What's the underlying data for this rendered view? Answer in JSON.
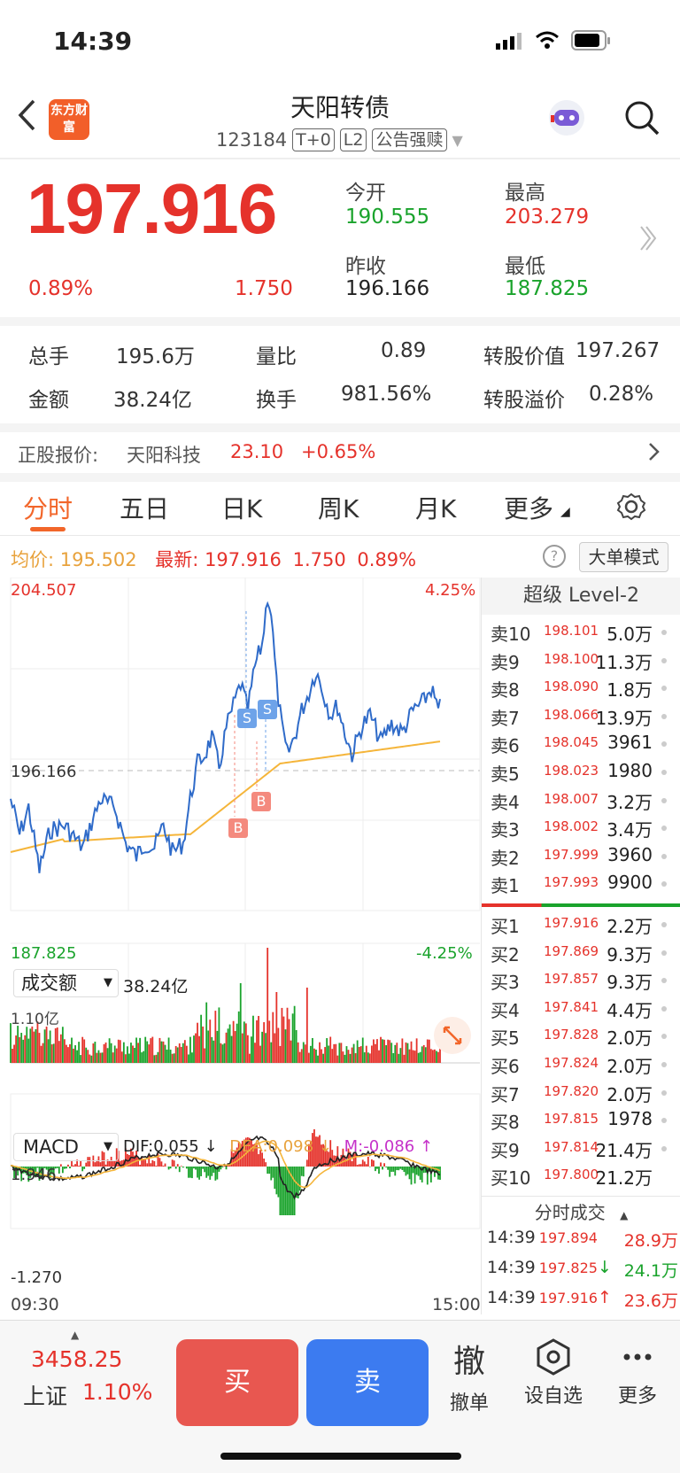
{
  "status": {
    "time": "14:39"
  },
  "header": {
    "title": "天阳转债",
    "code": "123184",
    "tags": [
      "T+0",
      "L2",
      "公告强赎"
    ],
    "logo": "东方财富"
  },
  "quote": {
    "price": "197.916",
    "change_pct": "0.89%",
    "change": "1.750",
    "open_label": "今开",
    "open": "190.555",
    "high_label": "最高",
    "high": "203.279",
    "prev_label": "昨收",
    "prev": "196.166",
    "low_label": "最低",
    "low": "187.825"
  },
  "stats": {
    "vol_label": "总手",
    "vol": "195.6万",
    "ratio_label": "量比",
    "ratio": "0.89",
    "conv_label": "转股价值",
    "conv": "197.267",
    "amt_label": "金额",
    "amt": "38.24亿",
    "turn_label": "换手",
    "turn": "981.56%",
    "prem_label": "转股溢价",
    "prem": "0.28%"
  },
  "stock": {
    "label": "正股报价:",
    "name": "天阳科技",
    "price": "23.10",
    "pct": "+0.65%"
  },
  "tabs": [
    "分时",
    "五日",
    "日K",
    "周K",
    "月K",
    "更多"
  ],
  "info": {
    "avg_label": "均价:",
    "avg": "195.502",
    "last_label": "最新:",
    "last": "197.916",
    "chg": "1.750",
    "pct": "0.89%",
    "mode": "大单模式"
  },
  "chart": {
    "y_max": "204.507",
    "y_mid": "196.166",
    "y_min": "187.825",
    "pct_max": "4.25%",
    "pct_min": "-4.25%",
    "vol_selector": "成交额",
    "vol_total": "38.24亿",
    "vol_max": "1.10亿",
    "macd_selector": "MACD",
    "dif": "DIF:0.055 ↓",
    "dea": "DEA:0.098 ↓",
    "m": "M:-0.086 ↑",
    "macd_max": "1.946",
    "macd_min": "-1.270",
    "t_start": "09:30",
    "t_end": "15:00",
    "b_label": "B",
    "s_label": "S"
  },
  "chart_data": {
    "type": "line",
    "x_range": [
      "09:30",
      "15:00"
    ],
    "ylim": [
      187.825,
      204.507
    ],
    "prev_close": 196.166,
    "series": [
      {
        "name": "均价",
        "last": 195.502
      }
    ],
    "volume_max": "1.10亿"
  },
  "level2": {
    "title": "超级 Level-2",
    "asks": [
      {
        "l": "卖10",
        "p": "198.101",
        "v": "5.0万"
      },
      {
        "l": "卖9",
        "p": "198.100",
        "v": "11.3万"
      },
      {
        "l": "卖8",
        "p": "198.090",
        "v": "1.8万"
      },
      {
        "l": "卖7",
        "p": "198.066",
        "v": "13.9万"
      },
      {
        "l": "卖6",
        "p": "198.045",
        "v": "3961"
      },
      {
        "l": "卖5",
        "p": "198.023",
        "v": "1980"
      },
      {
        "l": "卖4",
        "p": "198.007",
        "v": "3.2万"
      },
      {
        "l": "卖3",
        "p": "198.002",
        "v": "3.4万"
      },
      {
        "l": "卖2",
        "p": "197.999",
        "v": "3960"
      },
      {
        "l": "卖1",
        "p": "197.993",
        "v": "9900"
      }
    ],
    "bids": [
      {
        "l": "买1",
        "p": "197.916",
        "v": "2.2万"
      },
      {
        "l": "买2",
        "p": "197.869",
        "v": "9.3万"
      },
      {
        "l": "买3",
        "p": "197.857",
        "v": "9.3万"
      },
      {
        "l": "买4",
        "p": "197.841",
        "v": "4.4万"
      },
      {
        "l": "买5",
        "p": "197.828",
        "v": "2.0万"
      },
      {
        "l": "买6",
        "p": "197.824",
        "v": "2.0万"
      },
      {
        "l": "买7",
        "p": "197.820",
        "v": "2.0万"
      },
      {
        "l": "买8",
        "p": "197.815",
        "v": "1978"
      },
      {
        "l": "买9",
        "p": "197.814",
        "v": "21.4万"
      },
      {
        "l": "买10",
        "p": "197.800",
        "v": "21.2万"
      }
    ],
    "trades_title": "分时成交",
    "trades": [
      {
        "t": "14:39",
        "p": "197.894",
        "v": "28.9万",
        "c": "red",
        "arrow": ""
      },
      {
        "t": "14:39",
        "p": "197.825",
        "v": "24.1万",
        "c": "green",
        "arrow": "↓"
      },
      {
        "t": "14:39",
        "p": "197.916",
        "v": "23.6万",
        "c": "red",
        "arrow": "↑"
      }
    ]
  },
  "bottom": {
    "index_val": "3458.25",
    "index_name": "上证",
    "index_pct": "1.10%",
    "buy": "买",
    "sell": "卖",
    "cancel_glyph": "撤",
    "cancel": "撤单",
    "fav": "设自选",
    "more": "更多"
  }
}
